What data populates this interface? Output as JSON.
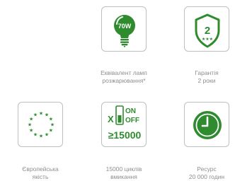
{
  "features": [
    {
      "badge": "70W",
      "caption_lines": [
        "Еквівалент ламп",
        "розжарювання*"
      ],
      "icon": "light-bulb-icon"
    },
    {
      "badge": "2",
      "caption_lines": [
        "Гарантія",
        "2 роки"
      ],
      "icon": "warranty-shield-icon"
    },
    {
      "caption_lines": [
        "Європейська",
        "якість"
      ],
      "icon": "eu-stars-icon"
    },
    {
      "on_label": "ON",
      "off_label": "OFF",
      "times": "X",
      "count": "≥15000",
      "caption_lines": [
        "15000 циклів",
        "вмикання"
      ],
      "icon": "switch-cycles-icon"
    },
    {
      "caption_lines": [
        "Ресурс",
        "20 000 годин"
      ],
      "icon": "clock-icon"
    }
  ],
  "colors": {
    "green": "#2e8b2e",
    "border": "#bfbfbf",
    "caption": "#8e8e8e"
  }
}
